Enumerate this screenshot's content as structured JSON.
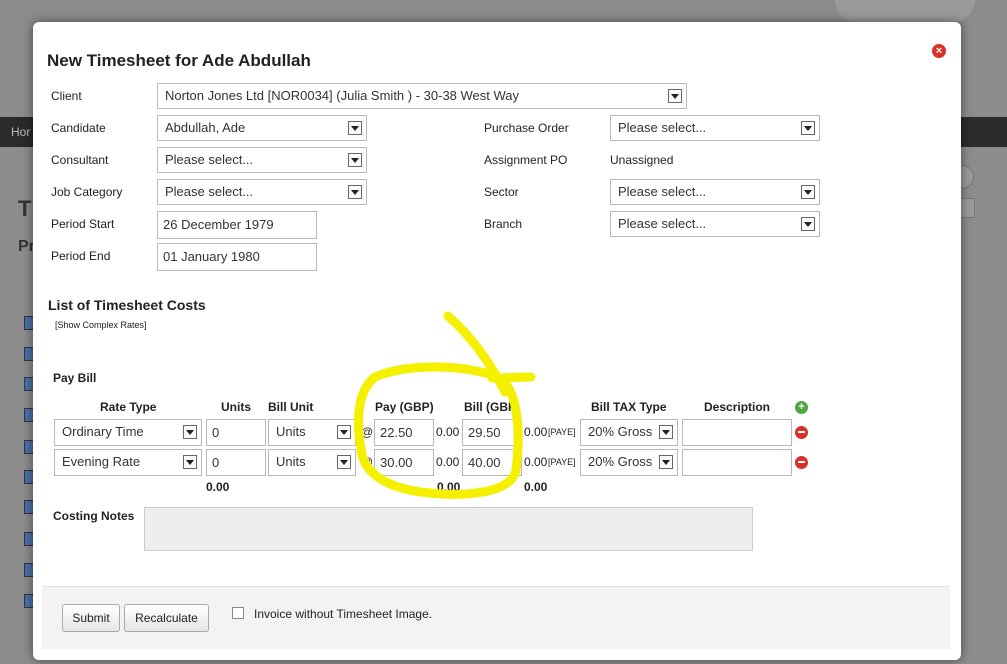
{
  "background": {
    "nav_label": "Hor",
    "letter_t": "T",
    "letter_p": "Pr"
  },
  "modal": {
    "title": "New Timesheet for Ade Abdullah",
    "fields": {
      "client_label": "Client",
      "client_value": "Norton Jones Ltd [NOR0034] (Julia Smith ) - 30-38 West Way",
      "candidate_label": "Candidate",
      "candidate_value": "Abdullah, Ade",
      "consultant_label": "Consultant",
      "consultant_value": "Please select...",
      "job_category_label": "Job Category",
      "job_category_value": "Please select...",
      "period_start_label": "Period Start",
      "period_start_value": "26 December 1979",
      "period_end_label": "Period End",
      "period_end_value": "01 January 1980",
      "purchase_order_label": "Purchase Order",
      "purchase_order_value": "Please select...",
      "assignment_po_label": "Assignment PO",
      "assignment_po_value": "Unassigned",
      "sector_label": "Sector",
      "sector_value": "Please select...",
      "branch_label": "Branch",
      "branch_value": "Please select..."
    },
    "costs": {
      "section_title": "List of Timesheet Costs",
      "complex_rates_link": "[Show Complex Rates]",
      "pay_bill_label": "Pay Bill",
      "headers": {
        "rate_type": "Rate Type",
        "units": "Units",
        "bill_unit": "Bill Unit",
        "pay": "Pay (GBP)",
        "bill": "Bill (GBP)",
        "bill_tax_type": "Bill TAX Type",
        "description": "Description"
      },
      "rows": [
        {
          "rate_type": "Ordinary Time",
          "units": "0",
          "bill_unit": "Units",
          "at": "@",
          "pay": "22.50",
          "pay_total": "0.00",
          "bill": "29.50",
          "bill_total": "0.00",
          "paye": "[PAYE]",
          "tax": "20% Gross",
          "description": ""
        },
        {
          "rate_type": "Evening Rate",
          "units": "0",
          "bill_unit": "Units",
          "at": "@",
          "pay": "30.00",
          "pay_total": "0.00",
          "bill": "40.00",
          "bill_total": "0.00",
          "paye": "[PAYE]",
          "tax": "20% Gross",
          "description": ""
        }
      ],
      "totals": {
        "units": "0.00",
        "pay": "0.00",
        "bill": "0.00"
      }
    },
    "costing_notes_label": "Costing Notes",
    "costing_notes_value": "",
    "footer": {
      "submit": "Submit",
      "recalculate": "Recalculate",
      "invoice_checkbox_label": "Invoice without Timesheet Image."
    }
  },
  "colors": {
    "annotation": "#f5f000",
    "close": "#d9302a",
    "add": "#4fa744"
  }
}
